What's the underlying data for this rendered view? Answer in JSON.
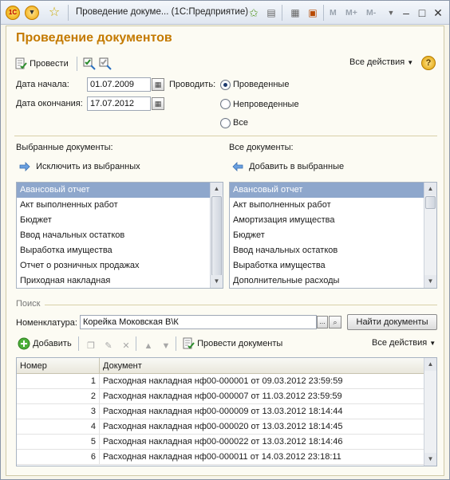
{
  "window": {
    "title": "Проведение докуме... (1С:Предприятие)",
    "logo_text": "1С",
    "m_buttons": [
      "M",
      "M+",
      "M-"
    ]
  },
  "form": {
    "title": "Проведение документов",
    "toolbar": {
      "post_label": "Провести",
      "all_actions_label": "Все действия",
      "help_label": "?"
    },
    "date_start": {
      "label": "Дата начала:",
      "value": "01.07.2009"
    },
    "date_end": {
      "label": "Дата окончания:",
      "value": "17.07.2012"
    },
    "post_mode": {
      "label": "Проводить:",
      "options": [
        "Проведенные",
        "Непроведенные",
        "Все"
      ],
      "selected": "Проведенные"
    },
    "selected_docs": {
      "title": "Выбранные документы:",
      "action_label": "Исключить из выбранных",
      "items": [
        "Авансовый отчет",
        "Акт выполненных работ",
        "Бюджет",
        "Ввод начальных остатков",
        "Выработка имущества",
        "Отчет о розничных продажах",
        "Приходная накладная"
      ]
    },
    "all_docs": {
      "title": "Все документы:",
      "action_label": "Добавить в выбранные",
      "items": [
        "Авансовый отчет",
        "Акт выполненных работ",
        "Амортизация имущества",
        "Бюджет",
        "Ввод начальных остатков",
        "Выработка имущества",
        "Дополнительные расходы"
      ]
    },
    "search": {
      "group_title": "Поиск",
      "nomenclature_label": "Номенклатура:",
      "nomenclature_value": "Корейка Моковская В\\К",
      "ellipsis": "...",
      "find_button_label": "Найти документы"
    },
    "table_toolbar": {
      "add_label": "Добавить",
      "post_docs_label": "Провести документы",
      "all_actions_label": "Все действия"
    },
    "table": {
      "columns": [
        "Номер",
        "Документ"
      ],
      "rows": [
        {
          "num": "1",
          "doc": "Расходная накладная нф00-000001 от 09.03.2012 23:59:59"
        },
        {
          "num": "2",
          "doc": "Расходная накладная нф00-000007 от 11.03.2012 23:59:59"
        },
        {
          "num": "3",
          "doc": "Расходная накладная нф00-000009 от 13.03.2012 18:14:44"
        },
        {
          "num": "4",
          "doc": "Расходная накладная нф00-000020 от 13.03.2012 18:14:45"
        },
        {
          "num": "5",
          "doc": "Расходная накладная нф00-000022 от 13.03.2012 18:14:46"
        },
        {
          "num": "6",
          "doc": "Расходная накладная нф00-000011 от 14.03.2012 23:18:11"
        }
      ]
    }
  },
  "colors": {
    "accent_title": "#c47a00",
    "selection": "#8ea7cc"
  }
}
